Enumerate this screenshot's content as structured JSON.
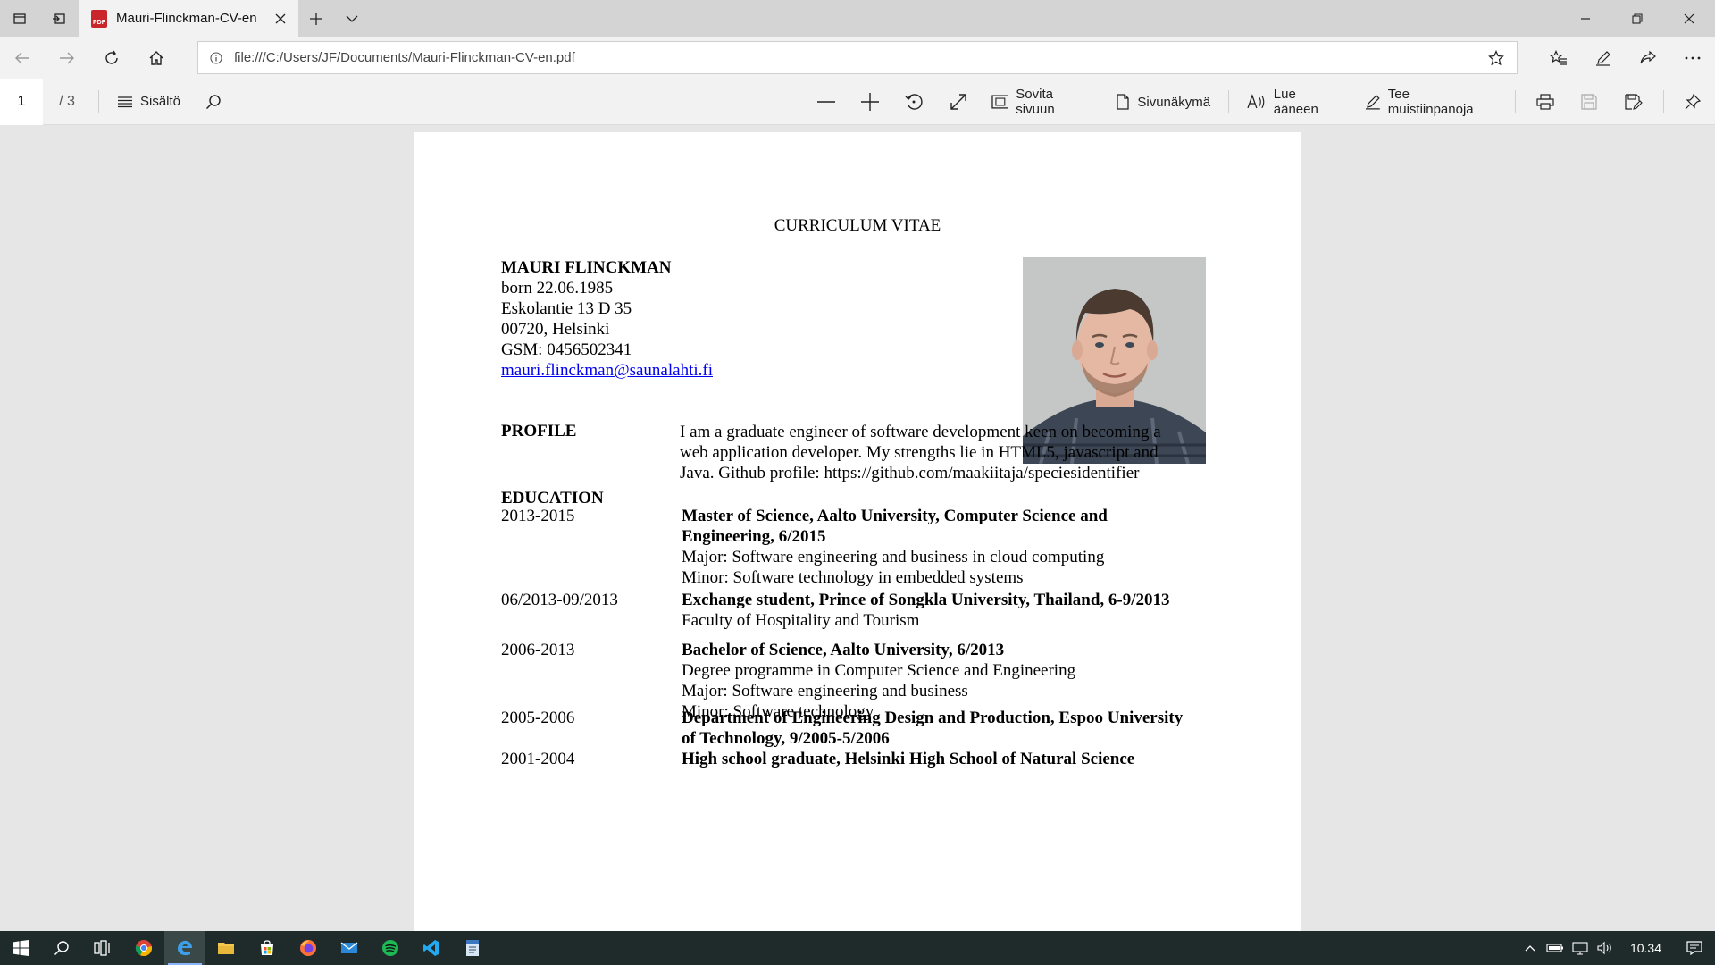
{
  "browser": {
    "tab_title": "Mauri-Flinckman-CV-en",
    "pdf_badge": "PDF",
    "url": "file:///C:/Users/JF/Documents/Mauri-Flinckman-CV-en.pdf"
  },
  "pdf_toolbar": {
    "current_page": "1",
    "total_pages": "/ 3",
    "contents_label": "Sisältö",
    "fit_page_label": "Sovita sivuun",
    "page_view_label": "Sivunäkymä",
    "read_aloud_label": "Lue ääneen",
    "notes_label": "Tee muistiinpanoja"
  },
  "document": {
    "title": "CURRICULUM VITAE",
    "contact": {
      "name": "MAURI FLINCKMAN",
      "born": "born 22.06.1985",
      "address1": "Eskolantie 13 D 35",
      "address2": "00720, Helsinki",
      "phone": "GSM: 0456502341",
      "email": "mauri.flinckman@saunalahti.fi"
    },
    "profile": {
      "heading": "PROFILE",
      "line1": "I am a graduate engineer of software development keen on becoming a",
      "line2": "web application developer. My strengths lie in HTML5, javascript and",
      "line3": "Java. Github profile: https://github.com/maakiitaja/speciesidentifier"
    },
    "education": {
      "heading": "EDUCATION",
      "entries": [
        {
          "years": "2013-2015",
          "title1": "Master of Science, Aalto University, Computer Science and",
          "title2": "Engineering, 6/2015",
          "line1": "Major: Software engineering and business in cloud computing",
          "line2": "Minor: Software technology in embedded systems"
        },
        {
          "years": "06/2013-09/2013",
          "title1": "Exchange student, Prince of Songkla University, Thailand, 6-9/2013",
          "line1": "Faculty of Hospitality and Tourism"
        },
        {
          "years": "2006-2013",
          "title1": "Bachelor of Science, Aalto University, 6/2013",
          "line1": "Degree programme in Computer Science and Engineering",
          "line2": "Major: Software engineering and business",
          "line3": "Minor: Software technology"
        },
        {
          "years": "2005-2006",
          "title1": "Department of Engineering Design and Production, Espoo University",
          "title2": "of Technology, 9/2005-5/2006"
        },
        {
          "years": "2001-2004",
          "title1": "High school graduate, Helsinki High School of Natural Science"
        }
      ]
    }
  },
  "taskbar": {
    "time": "10.34"
  },
  "colors": {
    "link": "#0000ee",
    "taskbar_bg": "#1f2a2a",
    "chrome_bg": "#f2f2f2",
    "pdf_icon_red": "#c8262b"
  }
}
